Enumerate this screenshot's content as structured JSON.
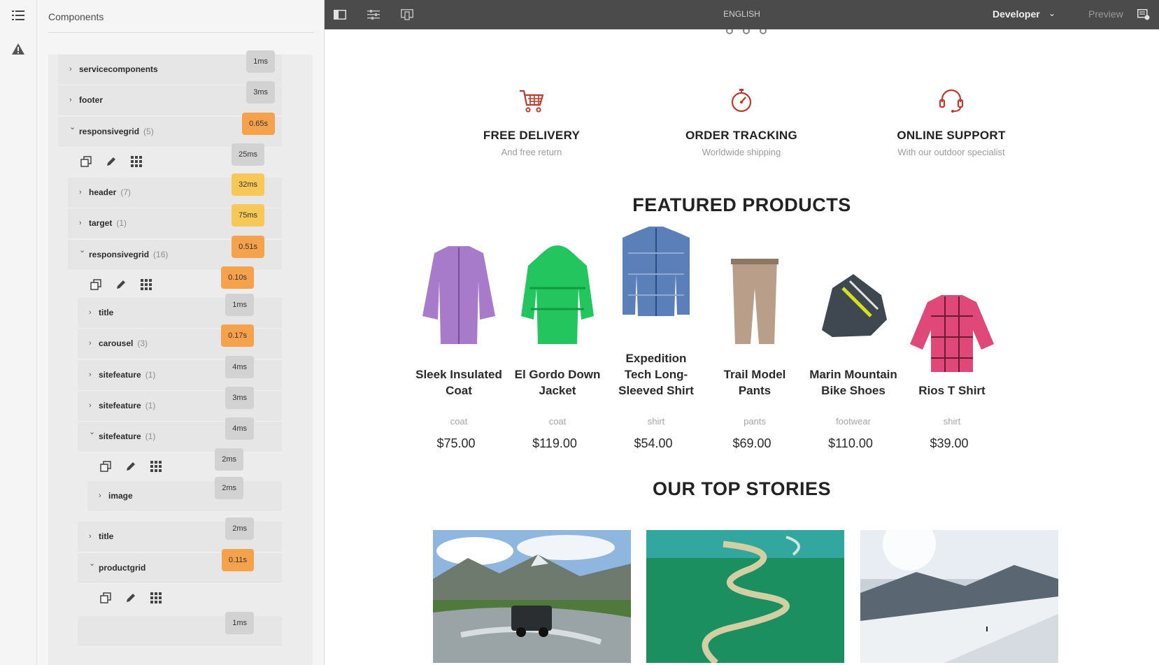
{
  "rail": {
    "outline_icon": "list-outline-icon",
    "warning_icon": "alert-triangle-icon"
  },
  "panel": {
    "title": "Components",
    "rows": [
      {
        "name": "servicecomponents",
        "count": "",
        "time": "1ms",
        "expanded": false
      },
      {
        "name": "footer",
        "count": "",
        "time": "3ms",
        "expanded": false
      },
      {
        "name": "responsivegrid",
        "count": "(5)",
        "time": "0.65s",
        "expanded": true
      },
      {
        "tools_time": "25ms"
      },
      {
        "name": "header",
        "count": "(7)",
        "time": "32ms",
        "expanded": false
      },
      {
        "name": "target",
        "count": "(1)",
        "time": "75ms",
        "expanded": false
      },
      {
        "name": "responsivegrid",
        "count": "(16)",
        "time": "0.51s",
        "expanded": true
      },
      {
        "tools_time": "0.10s"
      },
      {
        "name": "title",
        "count": "",
        "time": "1ms",
        "expanded": false
      },
      {
        "name": "carousel",
        "count": "(3)",
        "time": "0.17s",
        "expanded": false
      },
      {
        "name": "sitefeature",
        "count": "(1)",
        "time": "4ms",
        "expanded": false
      },
      {
        "name": "sitefeature",
        "count": "(1)",
        "time": "3ms",
        "expanded": false
      },
      {
        "name": "sitefeature",
        "count": "(1)",
        "time": "4ms",
        "expanded": true
      },
      {
        "tools_time": "2ms"
      },
      {
        "name": "image",
        "count": "",
        "time": "2ms",
        "expanded": false
      },
      {
        "name": "title",
        "count": "",
        "time": "2ms",
        "expanded": false
      },
      {
        "name": "productgrid",
        "count": "",
        "time": "0.11s",
        "expanded": true
      },
      {
        "tools_time": ""
      },
      {
        "time": "1ms"
      }
    ]
  },
  "toolbar": {
    "icons": [
      "side-panel-toggle-icon",
      "page-properties-icon",
      "emulator-icon"
    ],
    "language": "ENGLISH",
    "mode": "Developer",
    "preview": "Preview",
    "annotations_icon": "annotations-icon"
  },
  "features": [
    {
      "title": "FREE DELIVERY",
      "subtitle": "And free return",
      "icon": "shopping-cart-icon"
    },
    {
      "title": "ORDER TRACKING",
      "subtitle": "Worldwide shipping",
      "icon": "stopwatch-icon"
    },
    {
      "title": "ONLINE SUPPORT",
      "subtitle": "With our outdoor specialist",
      "icon": "headset-icon"
    }
  ],
  "featured_title": "FEATURED PRODUCTS",
  "products": [
    {
      "name_lines": [
        "Sleek Insulated",
        "Coat"
      ],
      "category": "coat",
      "price": "$75.00",
      "color": "#a77bc9"
    },
    {
      "name_lines": [
        "El Gordo Down",
        "Jacket"
      ],
      "category": "coat",
      "price": "$119.00",
      "color": "#22c55e"
    },
    {
      "name_lines": [
        "Expedition",
        "Tech Long-",
        "Sleeved Shirt"
      ],
      "category": "shirt",
      "price": "$54.00",
      "color": "#5b7fb8"
    },
    {
      "name_lines": [
        "Trail Model",
        "Pants"
      ],
      "category": "pants",
      "price": "$69.00",
      "color": "#b99e8a"
    },
    {
      "name_lines": [
        "Marin Mountain",
        "Bike Shoes"
      ],
      "category": "footwear",
      "price": "$110.00",
      "color": "#3f4750"
    },
    {
      "name_lines": [
        "Rios T Shirt"
      ],
      "category": "shirt",
      "price": "$39.00",
      "color": "#e0487a"
    }
  ],
  "stories_title": "OUR TOP STORIES"
}
